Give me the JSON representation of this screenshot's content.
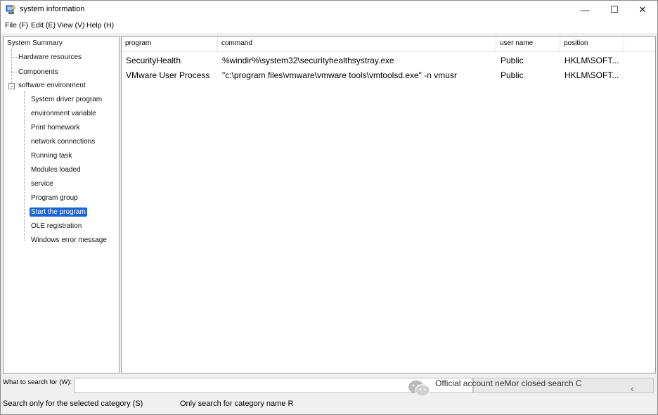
{
  "window": {
    "title": "system information",
    "controls": {
      "minimize": "—",
      "maximize": "☐",
      "close": "✕"
    }
  },
  "menu": [
    "File (F)",
    "Edit (E)",
    "View (V)",
    "Help (H)"
  ],
  "tree": {
    "root": "System Summary",
    "level1": [
      "Hardware resources",
      "Components",
      "software environment"
    ],
    "expander": "−",
    "software_children": [
      "System driver program",
      "environment variable",
      "Print homework",
      "network connections",
      "Running task",
      "Modules loaded",
      "service",
      "Program group",
      "Start the program",
      "OLE registration",
      "Windows error message"
    ],
    "selected": "Start the program"
  },
  "list": {
    "columns": [
      "program",
      "command",
      "user name",
      "position"
    ],
    "rows": [
      [
        "SecurityHealth",
        "%windir%\\system32\\securityhealthsystray.exe",
        "Public",
        "HKLM\\SOFT..."
      ],
      [
        "VMware User Process",
        "\"c:\\program files\\vmware\\vmware tools\\vmtoolsd.exe\" -n vmusr",
        "Public",
        "HKLM\\SOFT..."
      ]
    ]
  },
  "search": {
    "label": "What to search for (W):",
    "value": "",
    "overlay_text": "Official account neMor closed search C",
    "chevron": "‹",
    "option_selected_category": "Search only for the selected category (S)",
    "option_category_name": "Only search for category name R"
  }
}
